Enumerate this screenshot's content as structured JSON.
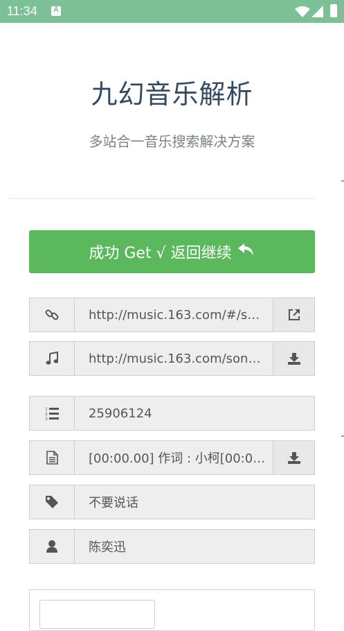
{
  "status_bar": {
    "time": "11:34"
  },
  "header": {
    "title": "九幻音乐解析",
    "subtitle": "多站合一音乐搜索解决方案"
  },
  "success_button": {
    "label": "成功 Get √ 返回继续"
  },
  "fields": {
    "link": {
      "value": "http://music.163.com/#/so...",
      "icon": "link-icon",
      "action_icon": "external-link-icon"
    },
    "music_url": {
      "value": "http://music.163.com/song...",
      "icon": "music-note-icon",
      "action_icon": "download-icon"
    },
    "song_id": {
      "value": "25906124",
      "icon": "ordered-list-icon"
    },
    "lyrics": {
      "value": "[00:00.00] 作词 : 小柯[00:01...",
      "icon": "file-text-icon",
      "action_icon": "download-icon"
    },
    "song_name": {
      "value": "不要说话",
      "icon": "tag-icon"
    },
    "artist": {
      "value": "陈奕迅",
      "icon": "user-icon"
    }
  },
  "colors": {
    "status_bar": "#7dbf96",
    "success": "#5cb85c",
    "title": "#34495e"
  }
}
